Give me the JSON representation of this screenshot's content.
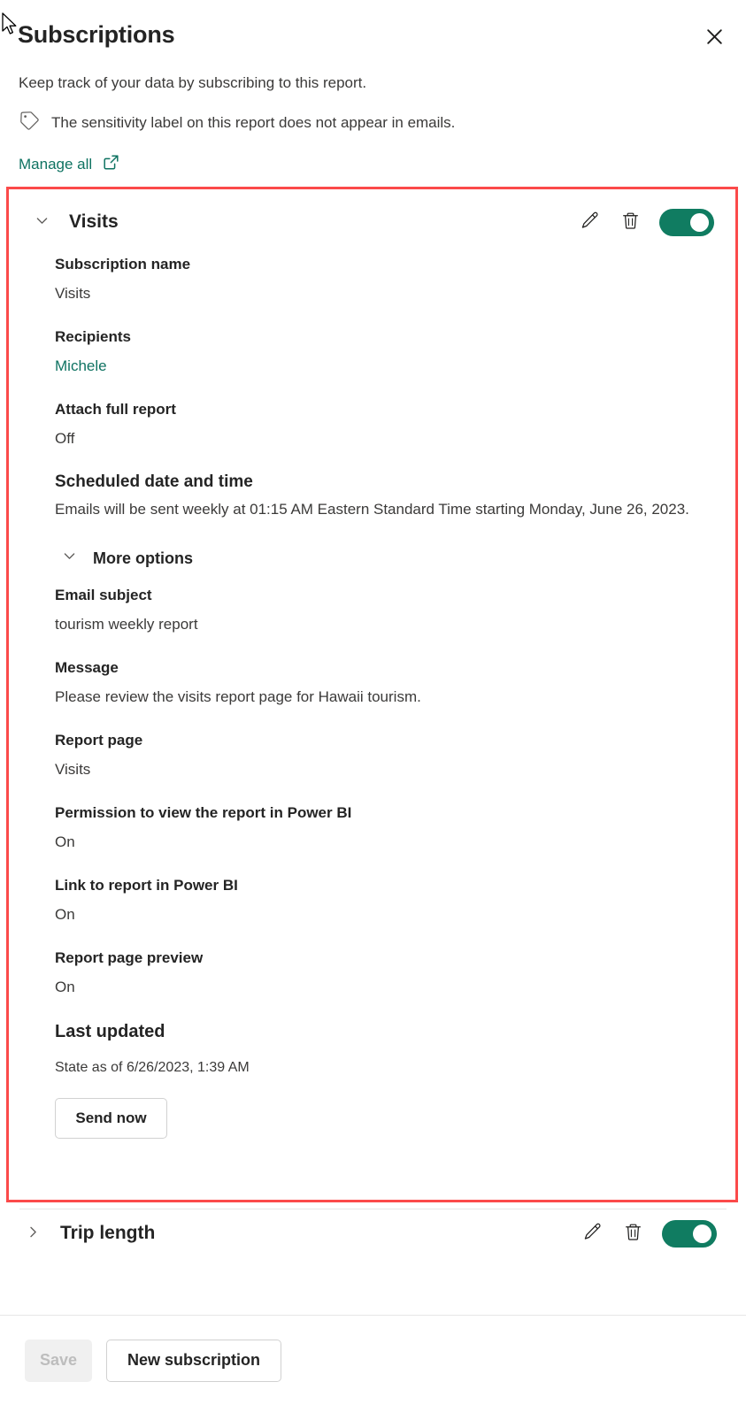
{
  "header": {
    "title": "Subscriptions",
    "close_icon": "close-icon",
    "subtitle": "Keep track of your data by subscribing to this report.",
    "sensitivity_icon": "tag-icon",
    "sensitivity_note": "The sensitivity label on this report does not appear in emails.",
    "manage_all_label": "Manage all",
    "manage_all_icon": "open-in-new-icon"
  },
  "subscriptions": [
    {
      "name": "Visits",
      "expanded": true,
      "chevron_icon": "chevron-down-icon",
      "edit_icon": "pencil-icon",
      "delete_icon": "trash-icon",
      "toggle_state": "on",
      "fields": {
        "subscription_name_label": "Subscription name",
        "subscription_name_value": "Visits",
        "recipients_label": "Recipients",
        "recipients_value": "Michele",
        "attach_label": "Attach full report",
        "attach_value": "Off",
        "schedule_label": "Scheduled date and time",
        "schedule_value": "Emails will be sent weekly at 01:15 AM Eastern Standard Time starting Monday, June 26, 2023.",
        "more_options_label": "More options",
        "more_options_icon": "chevron-down-icon",
        "email_subject_label": "Email subject",
        "email_subject_value": "tourism weekly report",
        "message_label": "Message",
        "message_value": "Please review the visits report page for Hawaii tourism.",
        "report_page_label": "Report page",
        "report_page_value": "Visits",
        "permission_label": "Permission to view the report in Power BI",
        "permission_value": "On",
        "link_label": "Link to report in Power BI",
        "link_value": "On",
        "preview_label": "Report page preview",
        "preview_value": "On",
        "last_updated_label": "Last updated",
        "last_updated_value": "State as of 6/26/2023, 1:39 AM",
        "send_now_label": "Send now"
      }
    },
    {
      "name": "Trip length",
      "expanded": false,
      "chevron_icon": "chevron-right-icon",
      "edit_icon": "pencil-icon",
      "delete_icon": "trash-icon",
      "toggle_state": "on"
    }
  ],
  "footer": {
    "save_label": "Save",
    "save_disabled": true,
    "new_subscription_label": "New subscription"
  },
  "colors": {
    "accent_teal": "#0f7362",
    "toggle_on": "#107c61",
    "highlight_red": "#fb4a4a",
    "text_primary": "#242424",
    "text_secondary": "#3b3a39",
    "disabled_bg": "#f0f0f0",
    "disabled_text": "#bdbdbd"
  }
}
